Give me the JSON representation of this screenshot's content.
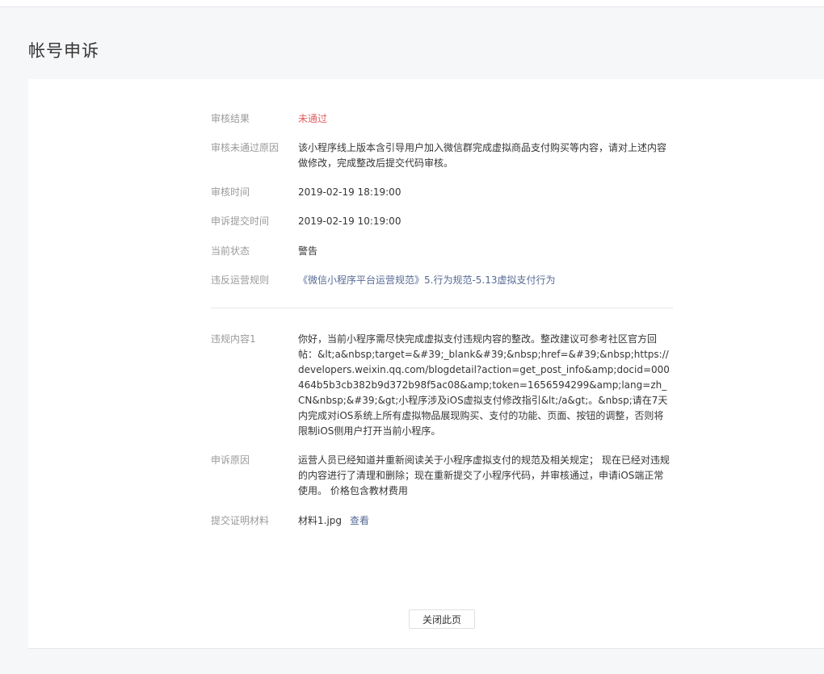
{
  "page": {
    "title": "帐号申诉"
  },
  "review": {
    "result_label": "审核结果",
    "result_value": "未通过",
    "reason_label": "审核未通过原因",
    "reason_value": "该小程序线上版本含引导用户加入微信群完成虚拟商品支付购买等内容，请对上述内容做修改，完成整改后提交代码审核。",
    "time_label": "审核时间",
    "time_value": "2019-02-19 18:19:00",
    "appeal_time_label": "申诉提交时间",
    "appeal_time_value": "2019-02-19 10:19:00",
    "status_label": "当前状态",
    "status_value": "警告",
    "rule_label": "违反运营规则",
    "rule_value": "《微信小程序平台运营规范》5.行为规范-5.13虚拟支付行为"
  },
  "violation": {
    "content_label": "违规内容1",
    "content_value": "你好，当前小程序需尽快完成虚拟支付违规内容的整改。整改建议可参考社区官方回帖：&lt;a&nbsp;target=&#39;_blank&#39;&nbsp;href=&#39;&nbsp;https://developers.weixin.qq.com/blogdetail?action=get_post_info&amp;docid=000464b5b3cb382b9d372b98f5ac08&amp;token=1656594299&amp;lang=zh_CN&nbsp;&#39;&gt;小程序涉及iOS虚拟支付修改指引&lt;/a&gt;。&nbsp;请在7天内完成对iOS系统上所有虚拟物品展现购买、支付的功能、页面、按钮的调整，否则将限制iOS侧用户打开当前小程序。",
    "appeal_reason_label": "申诉原因",
    "appeal_reason_value": "运营人员已经知道并重新阅读关于小程序虚拟支付的规范及相关规定； 现在已经对违规的内容进行了清理和删除；现在重新提交了小程序代码，并审核通过，申请iOS端正常使用。 价格包含教材费用",
    "proof_label": "提交证明材料",
    "proof_file": "材料1.jpg",
    "proof_view": "查看"
  },
  "actions": {
    "close_label": "关闭此页"
  },
  "colors": {
    "reject_red": "#e15f63",
    "link_blue": "#576b95",
    "label_gray": "#9a9a9a"
  }
}
